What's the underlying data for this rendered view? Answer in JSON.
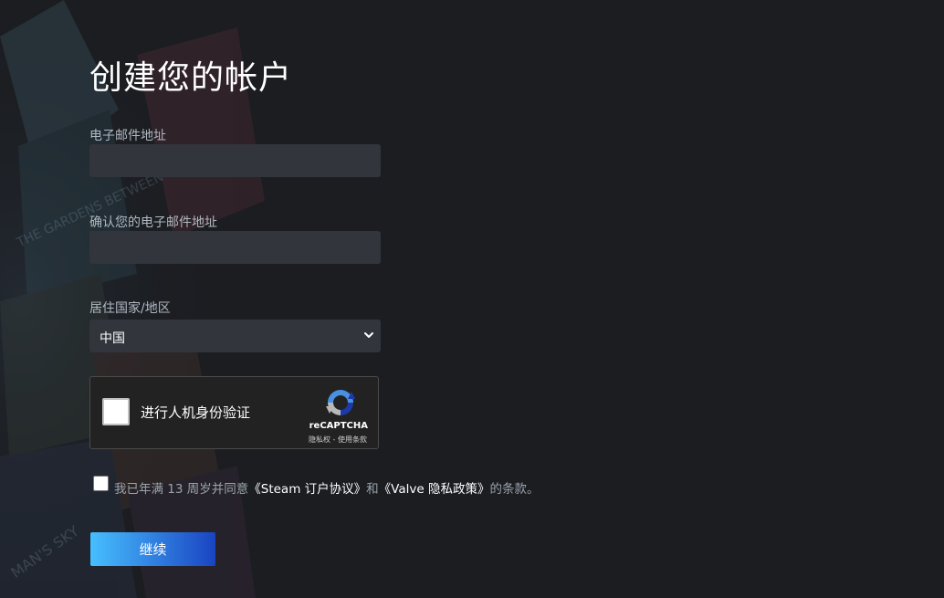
{
  "page": {
    "title": "创建您的帐户"
  },
  "form": {
    "email_label": "电子邮件地址",
    "email_value": "",
    "confirm_email_label": "确认您的电子邮件地址",
    "confirm_email_value": "",
    "country_label": "居住国家/地区",
    "country_value": "中国"
  },
  "recaptcha": {
    "checkbox_label": "进行人机身份验证",
    "brand": "reCAPTCHA",
    "privacy_link": "隐私权",
    "separator": " - ",
    "terms_link": "使用条款",
    "logo_icon": "recaptcha-logo-icon",
    "checked": false
  },
  "agreement": {
    "prefix": "我已年满 13 周岁并同意",
    "steam_link": "《Steam 订户协议》",
    "middle": "和",
    "valve_link": "《Valve 隐私政策》",
    "suffix": "的条款。",
    "checked": false
  },
  "actions": {
    "continue_label": "继续"
  },
  "background": {
    "game_art_text_1": "THE GARDENS BETWEEN",
    "game_art_text_2": "MAN'S SKY"
  },
  "colors": {
    "page_bg": "#1b1d21",
    "input_bg": "#32353c",
    "button_gradient_start": "#47bfff",
    "button_gradient_end": "#1a44c2",
    "link_color": "#ffffff",
    "muted_text": "#9aa3ac"
  }
}
